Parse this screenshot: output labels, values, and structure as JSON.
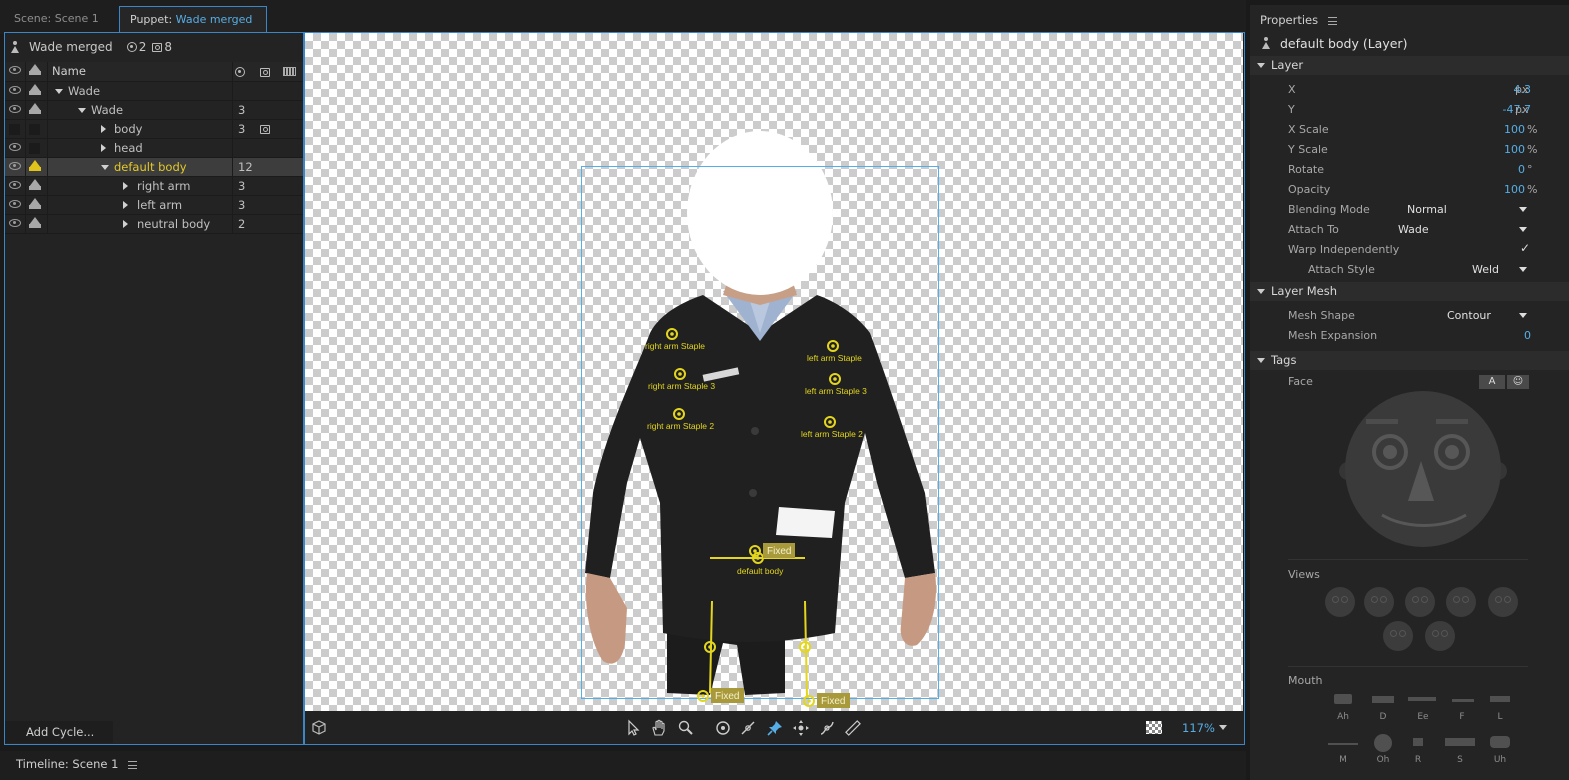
{
  "tabs": {
    "scene_label": "Scene: Scene 1",
    "puppet_prefix": "Puppet:",
    "puppet_name": "Wade merged"
  },
  "puppet_panel": {
    "name": "Wade merged",
    "handles_count": "2",
    "cameras_count": "8",
    "name_header": "Name",
    "rows": [
      {
        "label": "Wade",
        "count": ""
      },
      {
        "label": "Wade",
        "count": "3"
      },
      {
        "label": "body",
        "count": "3"
      },
      {
        "label": "head",
        "count": ""
      },
      {
        "label": "default body",
        "count": "12"
      },
      {
        "label": "right arm",
        "count": "3"
      },
      {
        "label": "left arm",
        "count": "3"
      },
      {
        "label": "neutral body",
        "count": "2"
      }
    ],
    "add_cycle": "Add Cycle..."
  },
  "canvas": {
    "handles": [
      {
        "label": "right arm Staple"
      },
      {
        "label": "left arm Staple"
      },
      {
        "label": "right arm Staple 3"
      },
      {
        "label": "left arm Staple 3"
      },
      {
        "label": "right arm Staple 2"
      },
      {
        "label": "left arm Staple 2"
      },
      {
        "label": "default body"
      }
    ],
    "fixed_label": "Fixed",
    "zoom": "117%"
  },
  "timeline": {
    "label": "Timeline: Scene 1"
  },
  "properties": {
    "title": "Properties",
    "layer_name": "default body (Layer)",
    "section_layer": "Layer",
    "x_label": "X",
    "x_value": "4.3",
    "x_unit": "px",
    "y_label": "Y",
    "y_value": "-47.7",
    "y_unit": "px",
    "xscale_label": "X Scale",
    "xscale_value": "100",
    "xscale_unit": "%",
    "yscale_label": "Y Scale",
    "yscale_value": "100",
    "yscale_unit": "%",
    "rotate_label": "Rotate",
    "rotate_value": "0",
    "rotate_unit": "°",
    "opacity_label": "Opacity",
    "opacity_value": "100",
    "opacity_unit": "%",
    "blending_label": "Blending Mode",
    "blending_value": "Normal",
    "attach_to_label": "Attach To",
    "attach_to_value": "Wade",
    "warp_label": "Warp Independently",
    "attach_style_label": "Attach Style",
    "attach_style_value": "Weld",
    "section_mesh": "Layer Mesh",
    "mesh_shape_label": "Mesh Shape",
    "mesh_shape_value": "Contour",
    "mesh_expansion_label": "Mesh Expansion",
    "mesh_expansion_value": "0",
    "section_tags": "Tags",
    "face_label": "Face",
    "tag_btn_a": "A",
    "views_label": "Views",
    "mouth_label": "Mouth",
    "mouth_shapes": [
      "Ah",
      "D",
      "Ee",
      "F",
      "L",
      "M",
      "Oh",
      "R",
      "S",
      "Uh"
    ]
  },
  "colors": {
    "accent_blue": "#56aee6",
    "handle_yellow": "#e4d61c",
    "selected_gold": "#e4c928"
  }
}
